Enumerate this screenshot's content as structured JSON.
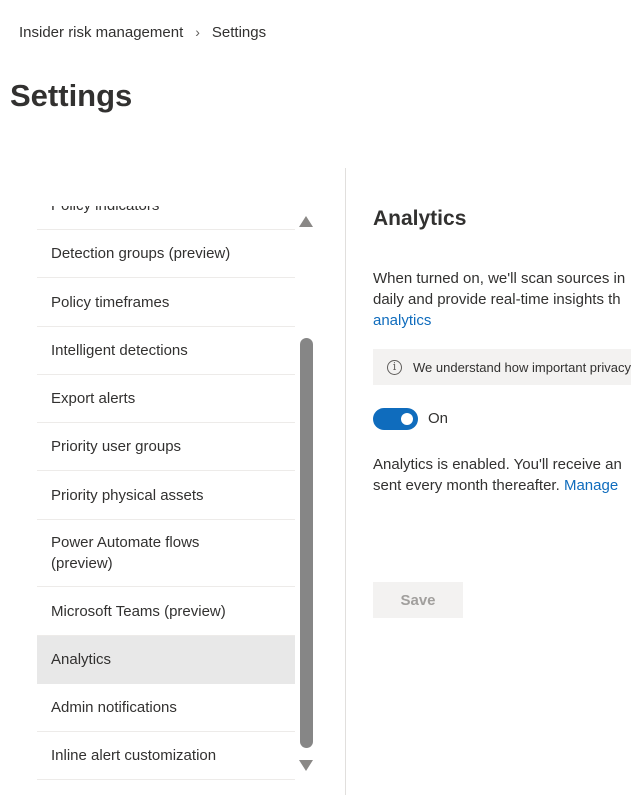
{
  "breadcrumb": {
    "items": [
      "Insider risk management",
      "Settings"
    ],
    "separator": ">"
  },
  "page_title": "Settings",
  "nav": {
    "items": [
      {
        "label": "Policy indicators",
        "selected": false
      },
      {
        "label": "Detection groups (preview)",
        "selected": false
      },
      {
        "label": "Policy timeframes",
        "selected": false
      },
      {
        "label": "Intelligent detections",
        "selected": false
      },
      {
        "label": "Export alerts",
        "selected": false
      },
      {
        "label": "Priority user groups",
        "selected": false
      },
      {
        "label": "Priority physical assets",
        "selected": false
      },
      {
        "label": "Power Automate flows (preview)",
        "selected": false
      },
      {
        "label": "Microsoft Teams (preview)",
        "selected": false
      },
      {
        "label": "Analytics",
        "selected": true
      },
      {
        "label": "Admin notifications",
        "selected": false
      },
      {
        "label": "Inline alert customization",
        "selected": false
      }
    ]
  },
  "main": {
    "title": "Analytics",
    "description_line1": "When turned on, we'll scan sources in",
    "description_line2": "daily and provide real-time insights th",
    "description_link": "analytics",
    "info_text": "We understand how important privacy",
    "toggle": {
      "state": "On",
      "on": true
    },
    "status_line1": "Analytics is enabled. You'll receive an",
    "status_line2_text": "sent every month thereafter.",
    "status_link": "Manage",
    "save_label": "Save"
  },
  "colors": {
    "accent": "#0f6cbd",
    "selected_bg": "#e8e8e8",
    "info_bg": "#f3f2f1"
  }
}
